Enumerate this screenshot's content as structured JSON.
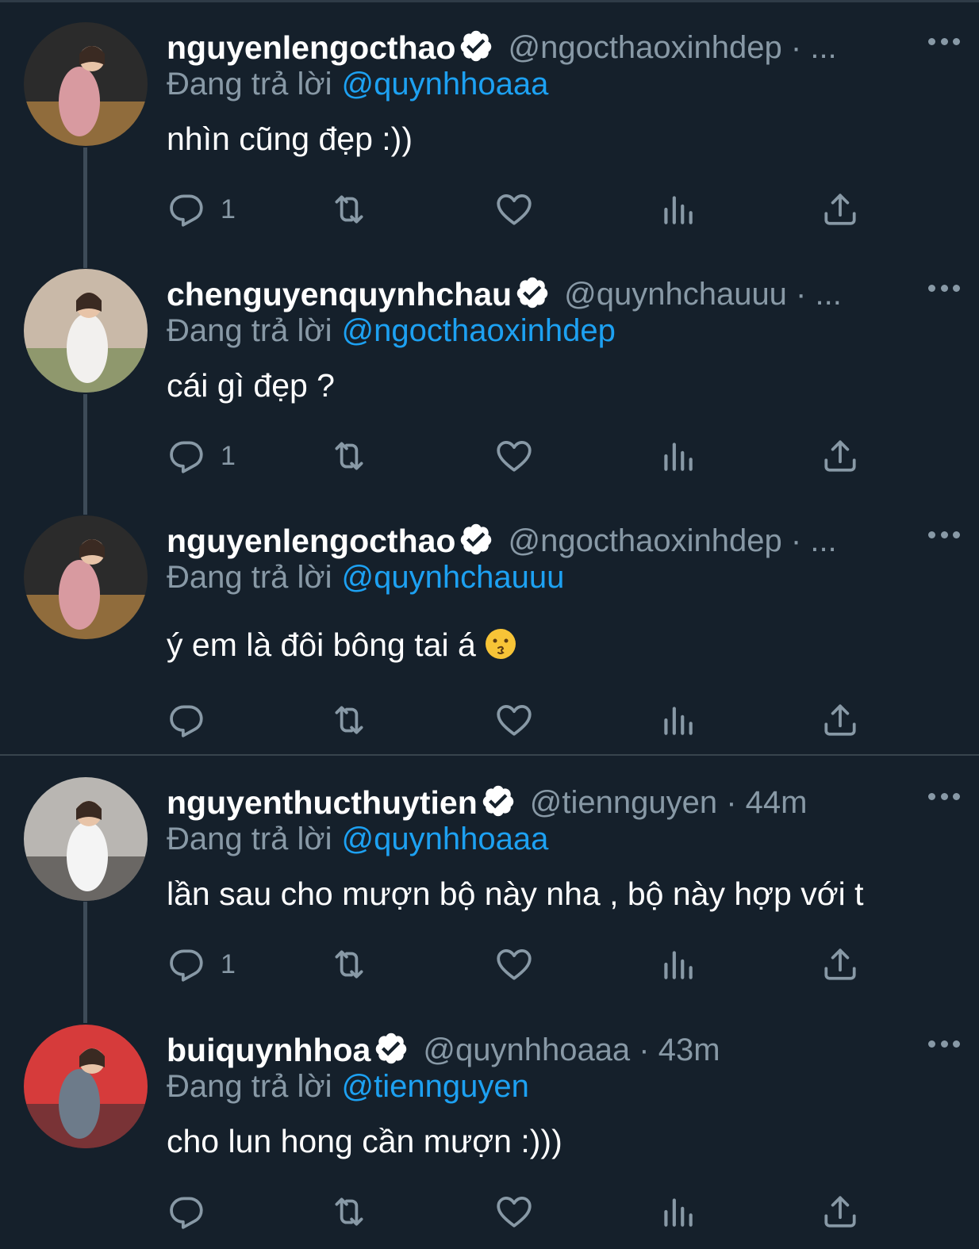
{
  "tweets": [
    {
      "display_name": "nguyenlengocthao",
      "handle": "@ngocthaoxinhdep · ...",
      "replying_label": "Đang trả lời",
      "replying_to": "@quynhhoaaa",
      "text": "nhìn cũng đẹp :))",
      "reply_count": "1",
      "avatar_colors": [
        "#2b2b2b",
        "#d89aa0",
        "#e3a24a"
      ]
    },
    {
      "display_name": "chenguyenquynhchau",
      "handle": "@quynhchauuu · ...",
      "replying_label": "Đang trả lời",
      "replying_to": "@ngocthaoxinhdep",
      "text": "cái gì đẹp ?",
      "reply_count": "1",
      "avatar_colors": [
        "#c9b9a8",
        "#f2f0ee",
        "#5e7d3c"
      ]
    },
    {
      "display_name": "nguyenlengocthao",
      "handle": "@ngocthaoxinhdep · ...",
      "replying_label": "Đang trả lời",
      "replying_to": "@quynhchauuu",
      "text": "ý em là đôi bông tai á",
      "text_emoji": "kissing-face",
      "reply_count": "",
      "avatar_colors": [
        "#2b2b2b",
        "#d89aa0",
        "#e3a24a"
      ]
    },
    {
      "display_name": "nguyenthucthuytien",
      "handle": "@tiennguyen · 44m",
      "replying_label": "Đang trả lời",
      "replying_to": "@quynhhoaaa",
      "text": "lần sau cho mượn bộ này nha , bộ này hợp với t",
      "reply_count": "1",
      "avatar_colors": [
        "#b9b6b2",
        "#f4f4f4",
        "#2a2624"
      ]
    },
    {
      "display_name": "buiquynhhoa",
      "handle": "@quynhhoaaa · 43m",
      "replying_label": "Đang trả lời",
      "replying_to": "@tiennguyen",
      "text": "cho lun hong cần mượn :)))",
      "reply_count": "",
      "avatar_colors": [
        "#d63b3b",
        "#6d7b8a",
        "#2d2d33"
      ]
    }
  ],
  "icons": {
    "reply": "reply-icon",
    "retweet": "retweet-icon",
    "like": "heart-icon",
    "views": "views-icon",
    "share": "share-icon",
    "verified": "verified-badge-icon",
    "more": "more-icon"
  },
  "colors": {
    "background": "#15202b",
    "text_primary": "#ffffff",
    "text_secondary": "#8899a6",
    "link": "#1da1f2",
    "thread_line": "#3d4b58"
  }
}
